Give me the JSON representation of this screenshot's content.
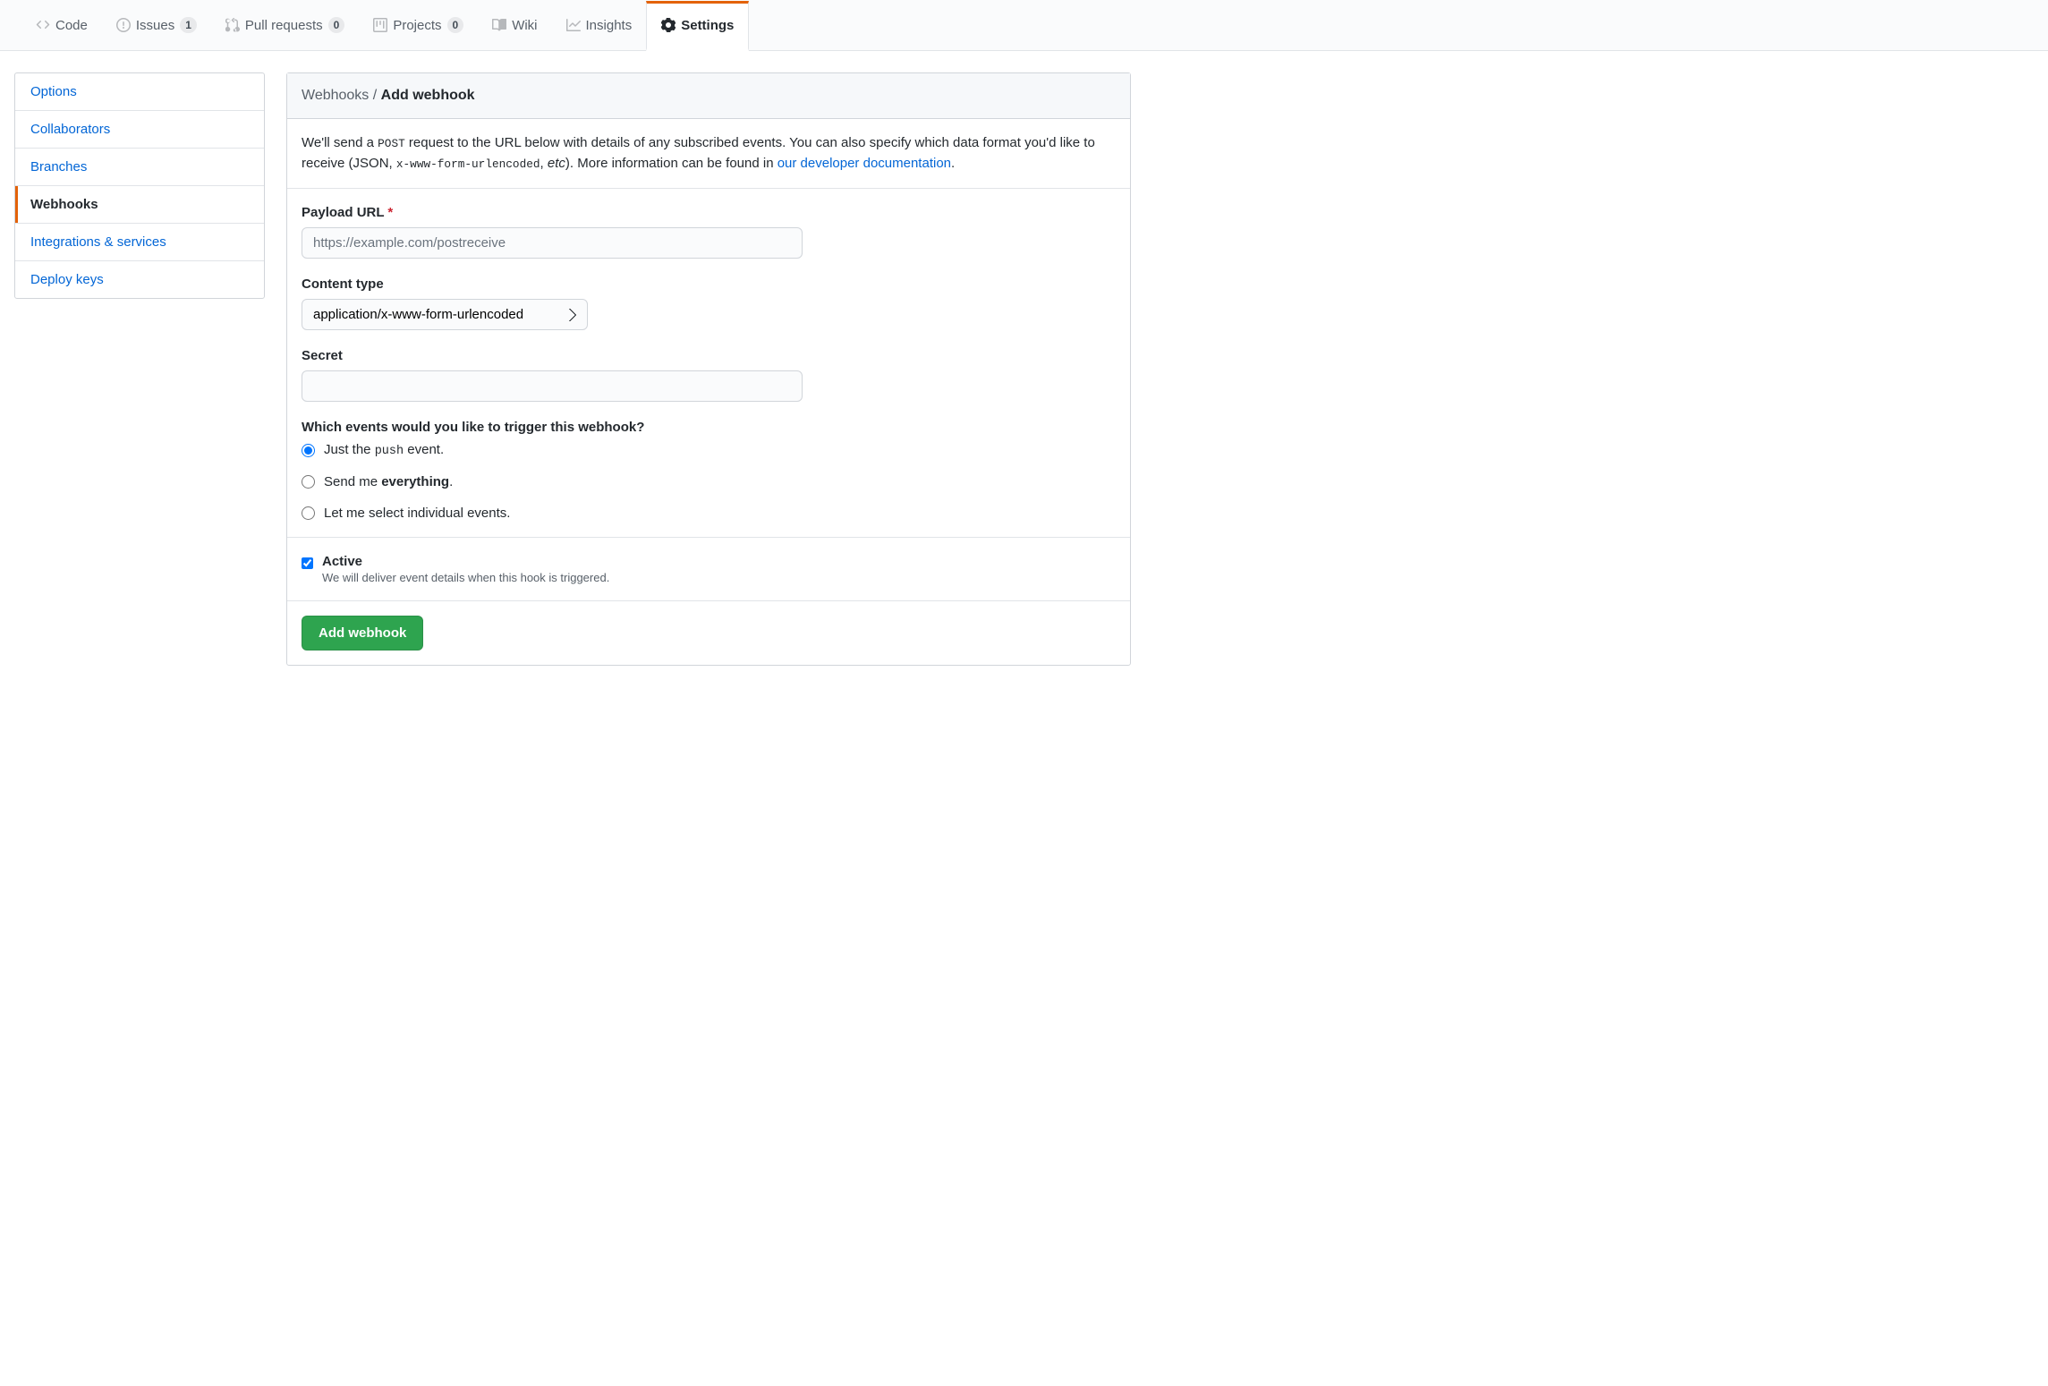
{
  "top_nav": {
    "code": "Code",
    "issues": "Issues",
    "issues_count": "1",
    "pull_requests": "Pull requests",
    "pull_requests_count": "0",
    "projects": "Projects",
    "projects_count": "0",
    "wiki": "Wiki",
    "insights": "Insights",
    "settings": "Settings"
  },
  "sidebar": {
    "options": "Options",
    "collaborators": "Collaborators",
    "branches": "Branches",
    "webhooks": "Webhooks",
    "integrations": "Integrations & services",
    "deploy_keys": "Deploy keys"
  },
  "header": {
    "crumb_parent": "Webhooks",
    "sep": " / ",
    "crumb_current": "Add webhook"
  },
  "intro": {
    "text1": "We'll send a ",
    "post": "POST",
    "text2": " request to the URL below with details of any subscribed events. You can also specify which data format you'd like to receive (JSON, ",
    "code": "x-www-form-urlencoded",
    "text3": ", ",
    "etc": "etc",
    "text4": "). More information can be found in ",
    "link": "our developer documentation",
    "text5": "."
  },
  "form": {
    "payload_url_label": "Payload URL",
    "payload_url_placeholder": "https://example.com/postreceive",
    "payload_url_value": "",
    "content_type_label": "Content type",
    "content_type_value": "application/x-www-form-urlencoded",
    "secret_label": "Secret",
    "secret_value": "",
    "events_question": "Which events would you like to trigger this webhook?",
    "event_push_pre": "Just the ",
    "event_push_code": "push",
    "event_push_post": " event.",
    "event_all_pre": "Send me ",
    "event_all_bold": "everything",
    "event_all_post": ".",
    "event_select": "Let me select individual events.",
    "active_label": "Active",
    "active_desc": "We will deliver event details when this hook is triggered.",
    "submit": "Add webhook"
  }
}
